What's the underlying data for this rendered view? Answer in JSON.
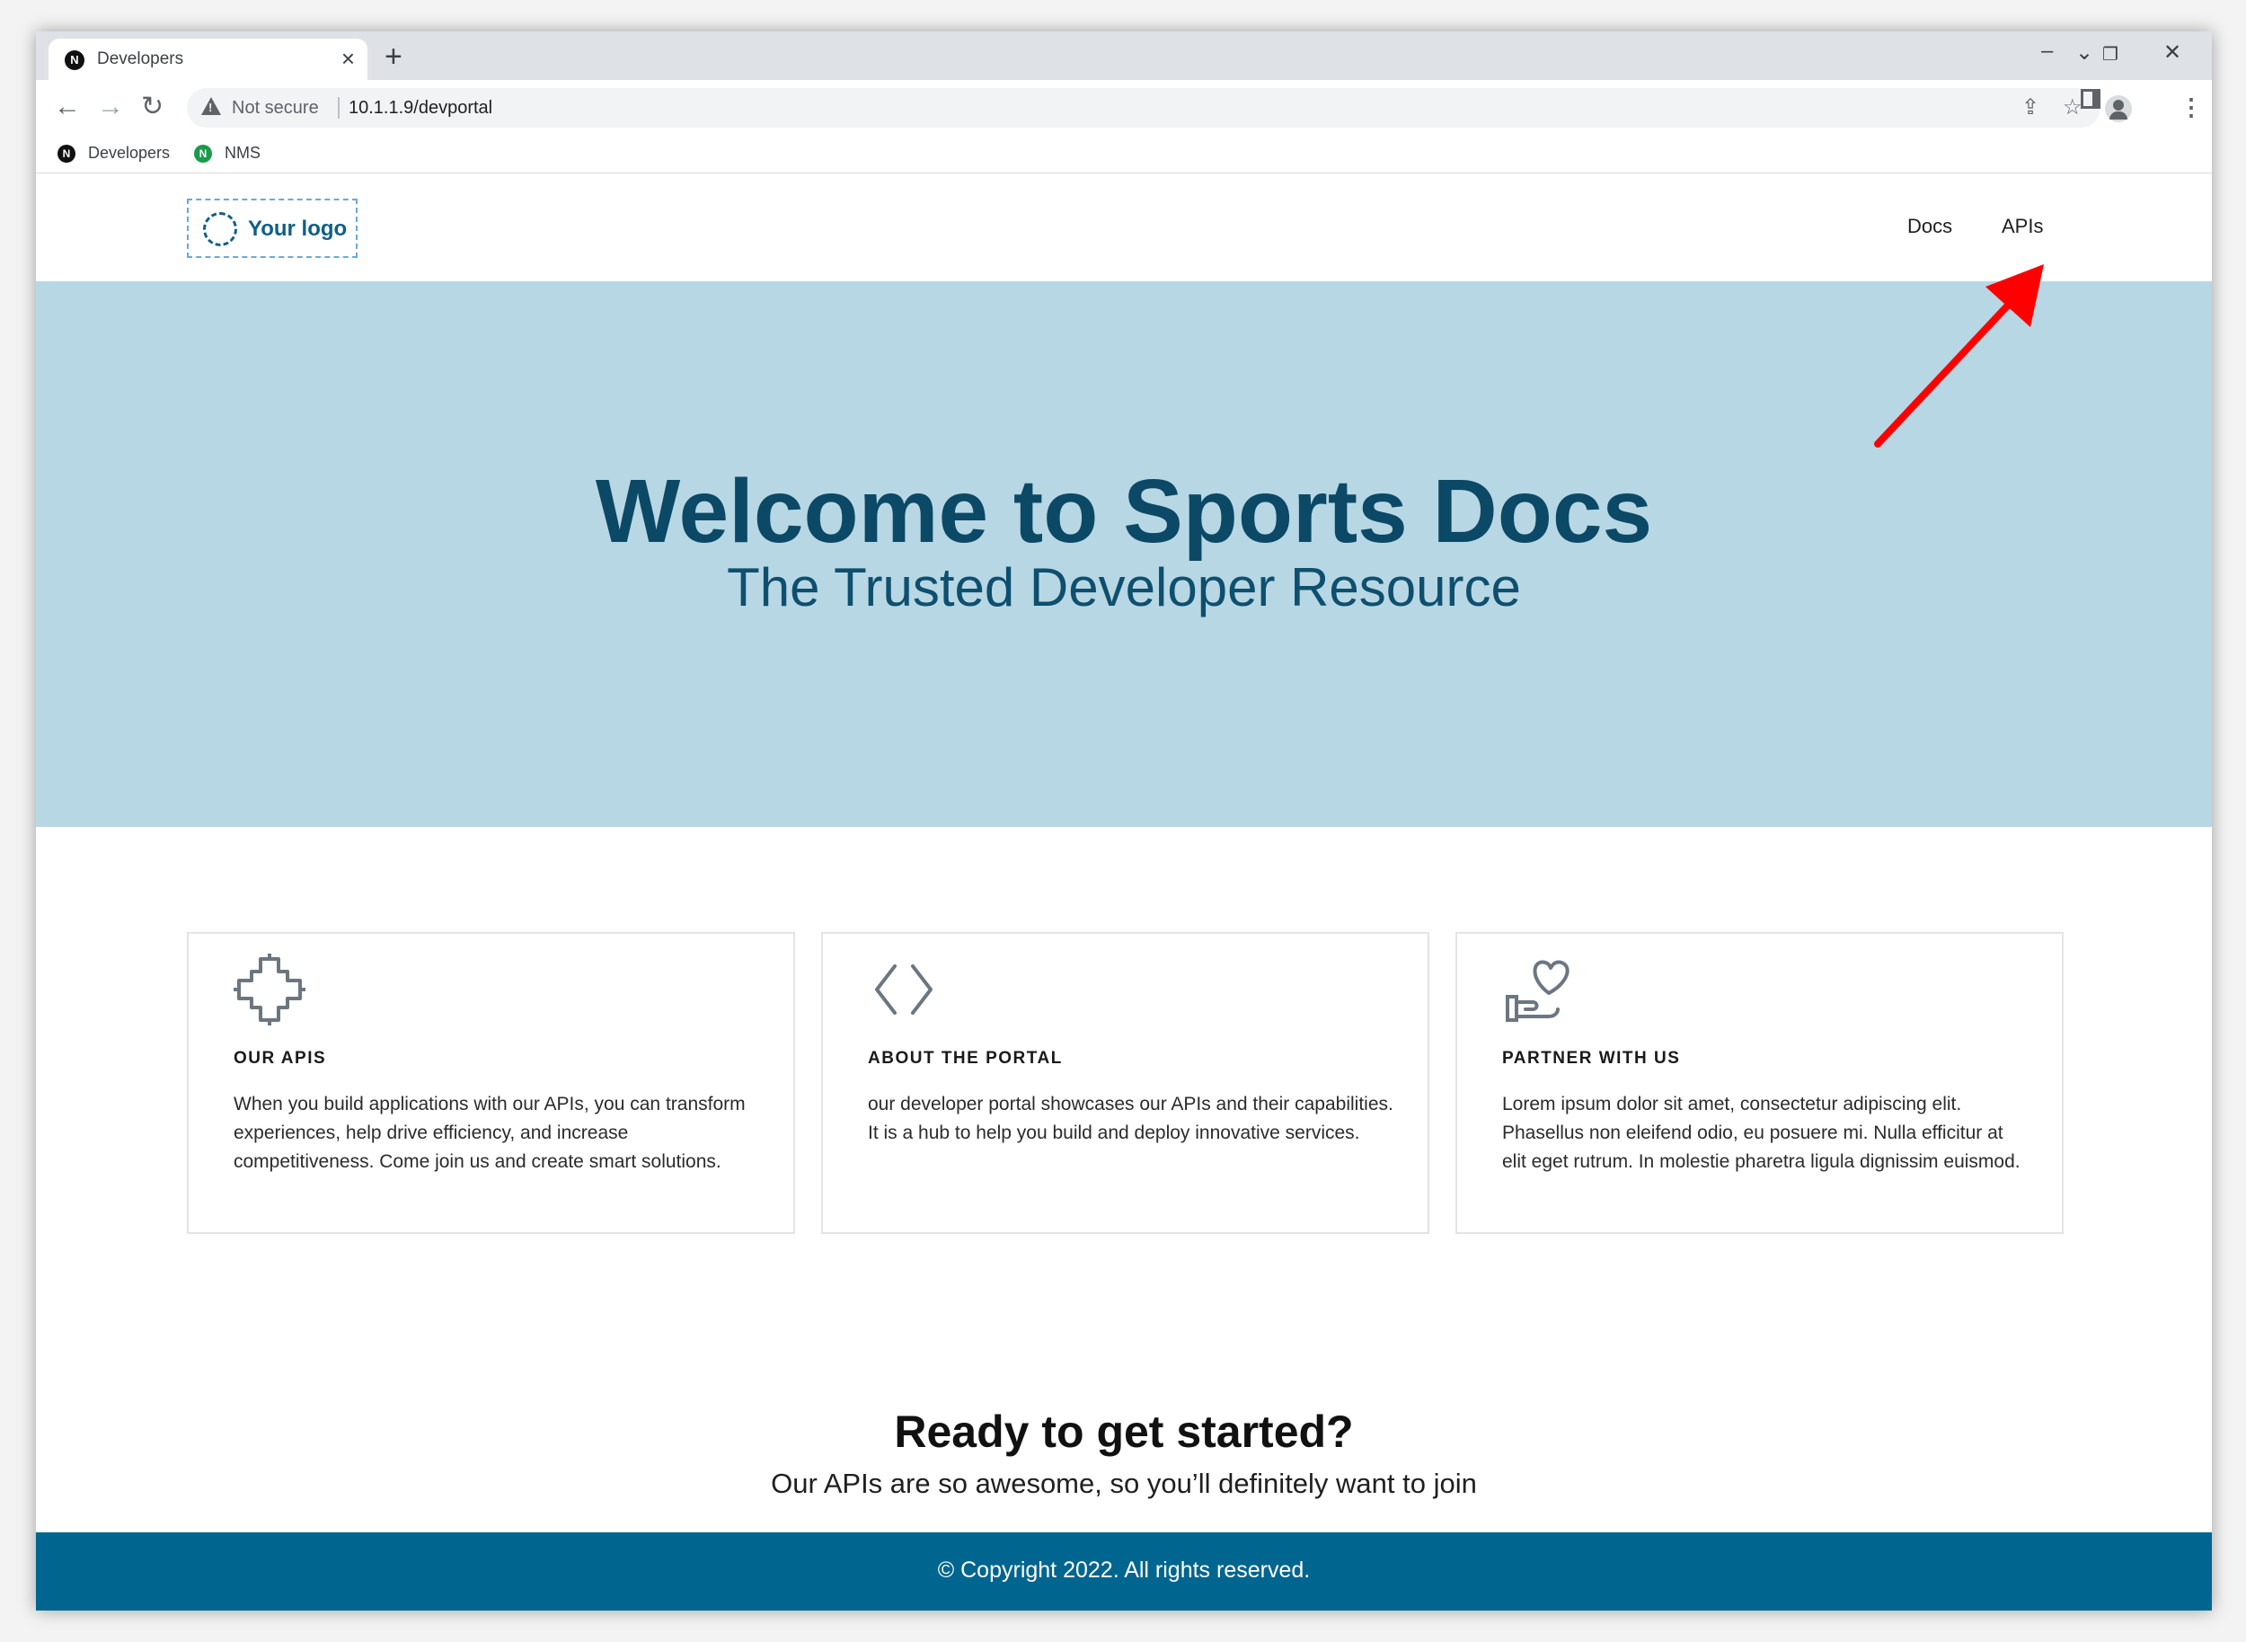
{
  "browser": {
    "tab_title": "Developers",
    "tab_favicon": "N",
    "new_tab": "+",
    "security_label": "Not secure",
    "url": "10.1.1.9/devportal",
    "bookmarks": [
      {
        "label": "Developers",
        "icon": "N",
        "color": "#111111"
      },
      {
        "label": "NMS",
        "icon": "N",
        "color": "#1a9a4b"
      }
    ]
  },
  "site": {
    "logo_text": "Your logo",
    "nav": [
      "Docs",
      "APIs"
    ],
    "hero_title": "Welcome to Sports Docs",
    "hero_subtitle": "The Trusted Developer Resource",
    "cards": [
      {
        "icon": "puzzle-cross-icon",
        "title": "OUR APIS",
        "body": "When you build applications with our APIs, you can transform experiences, help drive efficiency, and increase competitiveness. Come join us and create smart solutions."
      },
      {
        "icon": "code-brackets-icon",
        "title": "ABOUT THE PORTAL",
        "body": "our developer portal showcases our APIs and their capabilities. It is a hub to help you build and deploy innovative services."
      },
      {
        "icon": "heart-hand-icon",
        "title": "PARTNER WITH US",
        "body": "Lorem ipsum dolor sit amet, consectetur adipiscing elit. Phasellus non eleifend odio, eu posuere mi. Nulla efficitur at elit eget rutrum. In molestie pharetra ligula dignissim euismod."
      }
    ],
    "cta_title": "Ready to get started?",
    "cta_subtitle": "Our APIs are so awesome, so you’ll definitely want to join",
    "footer": "© Copyright 2022. All rights reserved."
  },
  "colors": {
    "hero_bg": "#b8d7e4",
    "hero_title": "#0b4966",
    "footer_bg": "#00658f",
    "annotation_arrow": "#ff0000"
  }
}
